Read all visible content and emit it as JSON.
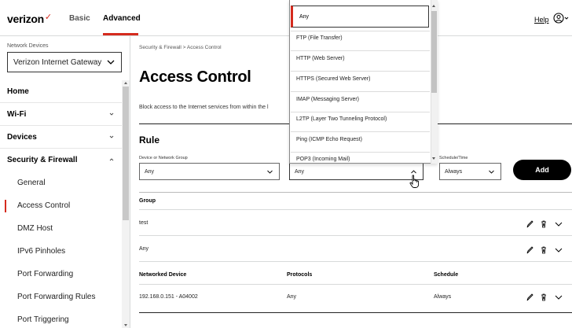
{
  "header": {
    "logo": "verizon",
    "logo_check": "✓",
    "nav_basic": "Basic",
    "nav_advanced": "Advanced",
    "help": "Help",
    "user_icon": "user-circle-icon"
  },
  "sidebar": {
    "network_devices_label": "Network Devices",
    "device_selected": "Verizon Internet Gateway",
    "items": [
      {
        "label": "Home",
        "level": "top"
      },
      {
        "label": "Wi-Fi",
        "level": "top"
      },
      {
        "label": "Devices",
        "level": "top"
      },
      {
        "label": "Security & Firewall",
        "level": "top"
      },
      {
        "label": "General",
        "level": "sub"
      },
      {
        "label": "Access Control",
        "level": "sub"
      },
      {
        "label": "DMZ Host",
        "level": "sub"
      },
      {
        "label": "IPv6 Pinholes",
        "level": "sub"
      },
      {
        "label": "Port Forwarding",
        "level": "sub"
      },
      {
        "label": "Port Forwarding Rules",
        "level": "sub"
      },
      {
        "label": "Port Triggering",
        "level": "sub"
      }
    ]
  },
  "main": {
    "breadcrumb": "Security & Firewall  >  Access Control",
    "title": "Access Control",
    "description": "Block access to the Internet services from within the l",
    "rule_title": "Rule",
    "fields": {
      "device_label": "Device or Network Group",
      "device_value": "Any",
      "protocol_value": "Any",
      "schedule_label": "Schedule/Time",
      "schedule_value": "Always"
    },
    "add_button": "Add",
    "group_table": {
      "header": "Group",
      "rows": [
        "test",
        "Any"
      ]
    },
    "device_table": {
      "headers": [
        "Networked Device",
        "Protocols",
        "Schedule"
      ],
      "rows": [
        [
          "192.168.0.151 - A04002",
          "Any",
          "Always"
        ]
      ]
    }
  },
  "dropdown": {
    "selected": "Any",
    "options": [
      "FTP (File Transfer)",
      "HTTP (Web Server)",
      "HTTPS (Secured Web Server)",
      "IMAP (Messaging Server)",
      "L2TP (Layer Two Tunneling Protocol)",
      "Ping (ICMP Echo Request)",
      "POP3 (Incoming Mail)"
    ]
  },
  "colors": {
    "accent": "#d52b1e",
    "text": "#000000",
    "button_bg": "#000000"
  }
}
